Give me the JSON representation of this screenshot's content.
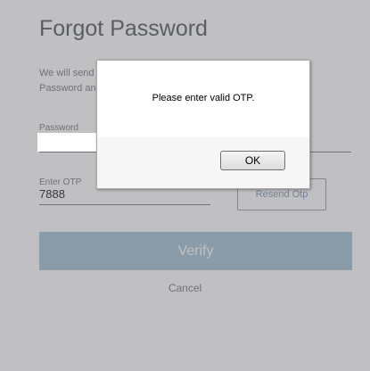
{
  "page": {
    "title": "Forgot Password",
    "description_line1": "We will send an OTP to your registered email. Enter",
    "description_line2": "Password and OTP below to reset your password."
  },
  "form": {
    "password_label": "Password",
    "otp_label": "Enter OTP",
    "otp_value": "7888",
    "resend_label": "Resend Otp",
    "verify_label": "Verify",
    "cancel_label": "Cancel"
  },
  "dialog": {
    "message": "Please enter valid OTP.",
    "ok_label": "OK"
  },
  "colors": {
    "verify_button": "#a8c5d8",
    "overlay": "#5a5a5f"
  }
}
